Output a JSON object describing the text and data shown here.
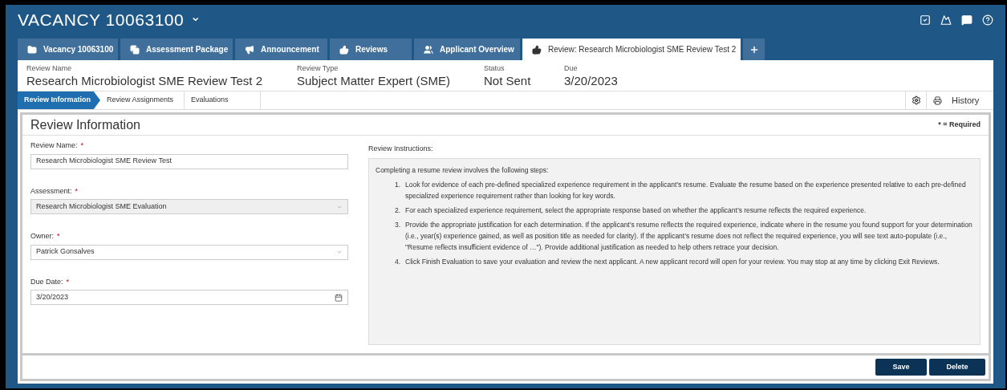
{
  "header": {
    "title": "VACANCY 10063100",
    "caret": "⌄"
  },
  "tabs": [
    {
      "label": "Vacancy 10063100",
      "selected": false
    },
    {
      "label": "Assessment Package",
      "selected": false
    },
    {
      "label": "Announcement",
      "selected": false
    },
    {
      "label": "Reviews",
      "selected": false
    },
    {
      "label": "Applicant Overview",
      "selected": false
    },
    {
      "label": "Review: Research Microbiologist SME Review Test 2",
      "selected": true
    }
  ],
  "summary": [
    {
      "label": "Review Name",
      "value": "Research Microbiologist SME Review Test 2"
    },
    {
      "label": "Review Type",
      "value": "Subject Matter Expert (SME)"
    },
    {
      "label": "Status",
      "value": "Not Sent"
    },
    {
      "label": "Due",
      "value": "3/20/2023"
    }
  ],
  "steps": [
    {
      "label": "Review Information",
      "selected": true
    },
    {
      "label": "Review Assignments",
      "selected": false
    },
    {
      "label": "Evaluations",
      "selected": false
    }
  ],
  "history_button": "History",
  "section": {
    "title": "Review Information",
    "required_note": "* = Required"
  },
  "fields": [
    {
      "kind": "text",
      "label": "Review Name:",
      "required_mark": "*",
      "value": "Research Microbiologist SME Review Test",
      "disabled": false
    },
    {
      "kind": "select",
      "label": "Assessment:",
      "required_mark": "*",
      "value": "Research Microbiologist SME Evaluation",
      "disabled": true
    },
    {
      "kind": "select",
      "label": "Owner:",
      "required_mark": "*",
      "value": "Patrick Gonsalves",
      "disabled": false
    },
    {
      "kind": "date",
      "label": "Due Date:",
      "required_mark": "*",
      "value": "3/20/2023",
      "disabled": false
    }
  ],
  "instructions": {
    "label": "Review Instructions:",
    "intro": "Completing a resume review involves the following steps:",
    "steps": [
      {
        "number": "1.",
        "text": "Look for evidence of each pre-defined specialized experience requirement in the applicant’s resume. Evaluate the resume based on the experience presented relative to each pre-defined specialized experience requirement rather than looking for key words."
      },
      {
        "number": "2.",
        "text": "For each specialized experience requirement, select the appropriate response based on whether the applicant’s resume reflects the required experience."
      },
      {
        "number": "3.",
        "text": "Provide the appropriate justification for each determination. If the applicant’s resume reflects the required experience, indicate where in the resume you found support for your determination (i.e., year(s) experience gained, as well as position title as needed for clarity). If the applicant’s resume does not reflect the required experience, you will see text auto-populate (i.e., \"Resume reflects insufficient evidence of …\"). Provide additional justification as needed to help others retrace your decision."
      },
      {
        "number": "4.",
        "text": "Click Finish Evaluation to save your evaluation and review the next applicant. A new applicant record will open for your review. You may stop at any time by clicking Exit Reviews."
      }
    ]
  },
  "buttons": [
    "Save",
    "Delete"
  ]
}
